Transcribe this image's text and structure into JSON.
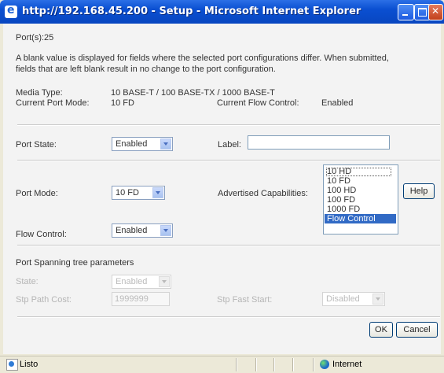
{
  "window": {
    "title": "http://192.168.45.200 - Setup - Microsoft Internet Explorer",
    "icon": "ie-icon"
  },
  "page": {
    "ports_label": "Port(s):25",
    "notice_line1": "A blank value is displayed for fields where the selected port configurations differ. When submitted,",
    "notice_line2": "fields that are left blank result in no change to the port configuration.",
    "media_type_label": "Media Type:",
    "media_type_value": "10 BASE-T / 100 BASE-TX / 1000 BASE-T",
    "current_port_mode_label": "Current Port Mode:",
    "current_port_mode_value": "10 FD",
    "current_flow_control_label": "Current Flow Control:",
    "current_flow_control_value": "Enabled",
    "port_state_label": "Port State:",
    "port_state_value": "Enabled",
    "label_label": "Label:",
    "label_value": "",
    "port_mode_label": "Port Mode:",
    "port_mode_value": "10 FD",
    "advertised_label": "Advertised Capabilities:",
    "advertised_options": [
      "10 HD",
      "10 FD",
      "100 HD",
      "100 FD",
      "1000 FD",
      "Flow Control"
    ],
    "advertised_selected": "Flow Control",
    "help_button": "Help",
    "flow_control_label": "Flow Control:",
    "flow_control_value": "Enabled",
    "stp_section_title": "Port Spanning tree parameters",
    "stp_state_label": "State:",
    "stp_state_value": "Enabled",
    "stp_path_cost_label": "Stp Path Cost:",
    "stp_path_cost_value": "1999999",
    "stp_fast_start_label": "Stp Fast Start:",
    "stp_fast_start_value": "Disabled",
    "ok_button": "OK",
    "cancel_button": "Cancel"
  },
  "statusbar": {
    "status_text": "Listo",
    "zone_text": "Internet"
  },
  "colors": {
    "titlebar": "#0a4fd1",
    "selection": "#316ac5",
    "content_bg": "#f3f3f3"
  }
}
